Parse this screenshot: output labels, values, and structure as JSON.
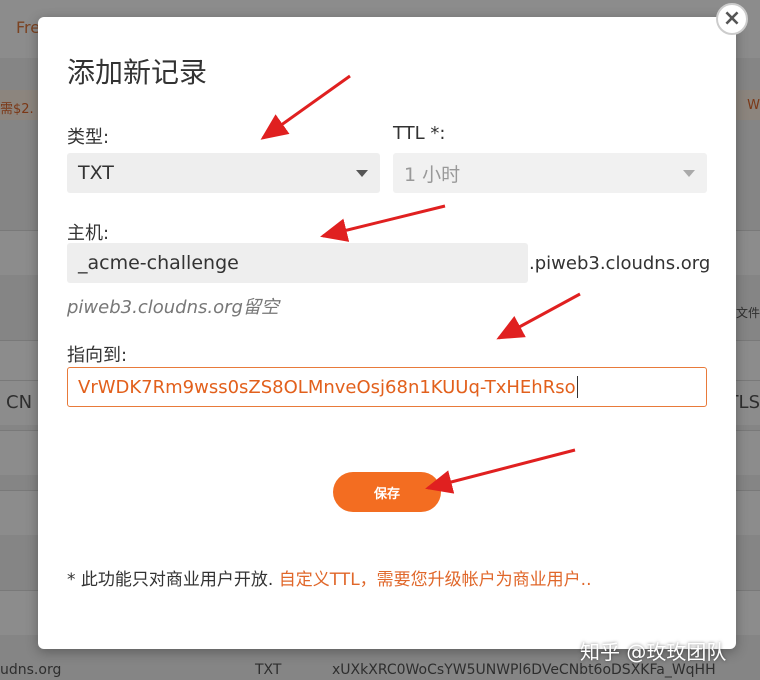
{
  "background": {
    "top_text": "Fre",
    "band_left": "需$2.",
    "band_right": "W",
    "side_left_1": "CN",
    "side_right_1": "TLS",
    "side_right_small": "文件",
    "bottom_domain": "udns.org",
    "bottom_type": "TXT",
    "bottom_value": "xUXkXRC0WoCsYW5UNWPl6DVeCNbt6oDSXKFa_WqHH"
  },
  "dialog": {
    "title": "添加新记录",
    "close_label": "×",
    "type_label": "类型:",
    "type_value": "TXT",
    "ttl_label": "TTL *:",
    "ttl_value": "1 小时",
    "host_label": "主机:",
    "host_value": "_acme-challenge",
    "host_suffix": ".piweb3.cloudns.org",
    "host_hint": "piweb3.cloudns.org留空",
    "target_label": "指向到:",
    "target_value": "VrWDK7Rm9wss0sZS8OLMnveOsj68n1KUUq-TxHEhRso",
    "save_label": "保存",
    "footer_note": "* 此功能只对商业用户开放.",
    "footer_link": "自定义TTL，需要您升级帐户为商业用户.."
  },
  "watermark": "知乎 @玫玫团队",
  "colors": {
    "accent": "#f36d21",
    "arrow": "#e02020",
    "link": "#e0672a"
  }
}
